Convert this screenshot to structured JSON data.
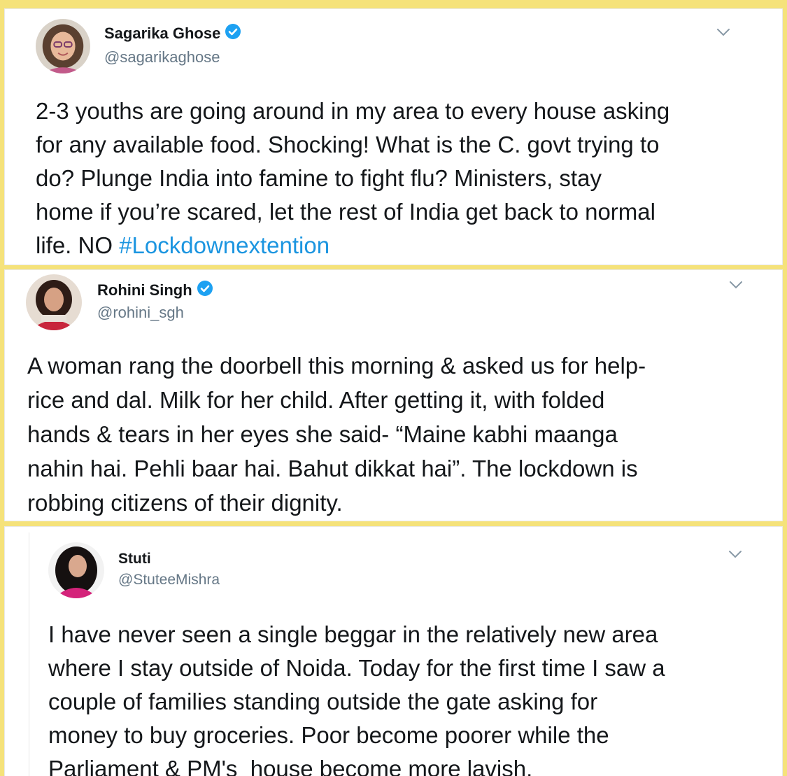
{
  "tweets": [
    {
      "name": "Sagarika Ghose",
      "verified": true,
      "handle": "@sagarikaghose",
      "lines": [
        "2-3 youths are going around in my area to every house asking",
        "for any available food. Shocking! What is the C. govt trying to",
        "do? Plunge India into famine to fight flu? Ministers, stay",
        "home if you’re scared, let the rest of India get back to normal"
      ],
      "last_line_prefix": "life. NO ",
      "hashtag": "#Lockdownextention",
      "avatar_icon": "profile-photo-icon"
    },
    {
      "name": "Rohini Singh",
      "verified": true,
      "handle": "@rohini_sgh",
      "lines": [
        "A woman rang the doorbell this morning & asked us for help-",
        "rice and dal. Milk for her child. After getting it, with folded",
        "hands & tears in her eyes she said- “Maine kabhi maanga",
        "nahin hai. Pehli baar hai. Bahut dikkat hai”. The lockdown is",
        "robbing citizens of their dignity."
      ],
      "avatar_icon": "profile-photo-icon"
    },
    {
      "name": "Stuti",
      "verified": false,
      "handle": "@StuteeMishra",
      "lines": [
        "I have never seen a single beggar in the relatively new area",
        "where I stay outside of Noida. Today for the first time I saw a",
        "couple of families standing outside the gate asking for",
        "money to buy groceries. Poor become poorer while the",
        "Parliament & PM's  house become more lavish."
      ],
      "avatar_icon": "profile-photo-icon"
    }
  ],
  "colors": {
    "frame": "#f5e27a",
    "text": "#14171a",
    "handle": "#657786",
    "hashtag": "#1b95e0",
    "verified": "#1da1f2"
  }
}
